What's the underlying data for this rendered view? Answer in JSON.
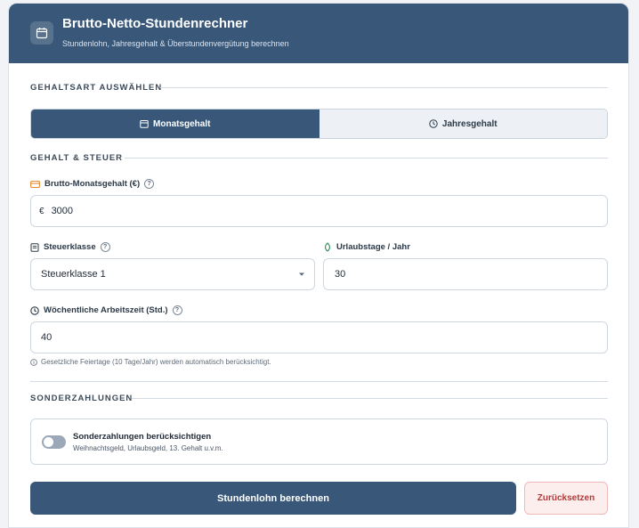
{
  "header": {
    "title": "Brutto-Netto-Stundenrechner",
    "subtitle": "Stundenlohn, Jahresgehalt & Überstundenvergütung berechnen",
    "icon": "calendar-icon"
  },
  "salary_type": {
    "section_title": "GEHALTSART AUSWÄHLEN",
    "options": [
      {
        "label": "Monatsgehalt",
        "icon": "calendar-icon",
        "active": true
      },
      {
        "label": "Jahresgehalt",
        "icon": "clock-icon",
        "active": false
      }
    ]
  },
  "salary_tax": {
    "section_title": "GEHALT & STEUER",
    "gross": {
      "label": "Brutto-Monatsgehalt (€)",
      "currency": "€",
      "value": "3000",
      "icon": "wallet-icon"
    },
    "tax_class": {
      "label": "Steuerklasse",
      "value": "Steuerklasse 1",
      "icon": "document-icon"
    },
    "vacation": {
      "label": "Urlaubstage / Jahr",
      "value": "30",
      "icon": "leaf-icon"
    },
    "hours": {
      "label": "Wöchentliche Arbeitszeit (Std.)",
      "value": "40",
      "icon": "clock-icon"
    },
    "hint": "Gesetzliche Feiertage (10 Tage/Jahr) werden automatisch berücksichtigt."
  },
  "special_payments": {
    "section_title": "SONDERZAHLUNGEN",
    "toggle_label": "Sonderzahlungen berücksichtigen",
    "toggle_sub": "Weihnachtsgeld, Urlaubsgeld, 13. Gehalt u.v.m.",
    "enabled": false
  },
  "actions": {
    "calculate": "Stundenlohn berechnen",
    "reset": "Zurücksetzen"
  },
  "colors": {
    "primary": "#385779",
    "reset_text": "#b23b3b",
    "reset_bg": "#fdeeee",
    "accent_orange": "#e08a2e",
    "accent_green": "#2f8a57"
  }
}
